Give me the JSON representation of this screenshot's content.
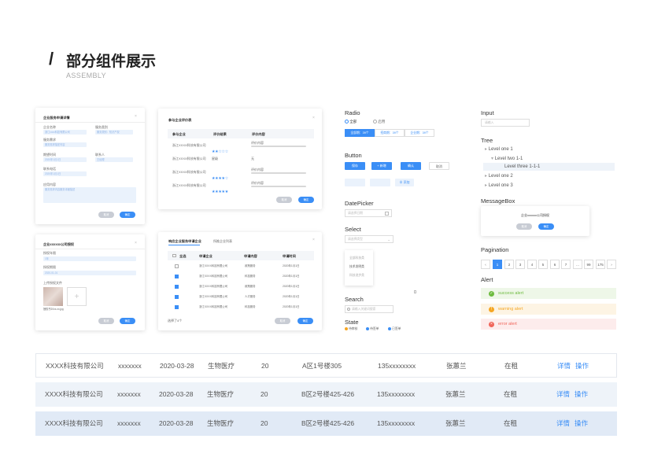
{
  "header": {
    "slash": "/",
    "title": "部分组件展示",
    "subtitle": "ASSEMBLY"
  },
  "card1": {
    "title": "企业服务申请详情",
    "labels": [
      "企业名称",
      "服务类别",
      "服务需求",
      "期望时间",
      "联系电话",
      "联系人",
      "应用内容"
    ],
    "values": [
      "浙江xxxx科技有限公司",
      "服务类别：知识产权",
      "服务需求描述内容",
      "2020年1月1日",
      "2020年1月1日",
      "王经理",
      "服务需求内容服务详细描述"
    ],
    "btn_cancel": "取消",
    "btn_ok": "确定"
  },
  "card2": {
    "title": "参与企业评价表",
    "headers": [
      "参与企业",
      "评价结果",
      "评价内容"
    ],
    "rows": [
      {
        "company": "浙江XXXX科技有限公司",
        "stars": "★★☆☆☆",
        "content": "评价内容"
      },
      {
        "company": "浙江XXXX科技有限公司",
        "stars": "星级",
        "content": "无"
      },
      {
        "company": "浙江XXXX科技有限公司",
        "stars": "★★★★☆",
        "content": "评价内容"
      },
      {
        "company": "浙江XXXX科技有限公司",
        "stars": "★★★★★",
        "content": "评价内容"
      }
    ],
    "btn_cancel": "取消",
    "btn_ok": "确定"
  },
  "card3": {
    "title": "企业xxxxxx公司授权",
    "labels": [
      "授权年限",
      "授权期限",
      "上传授权文件"
    ],
    "values": [
      "1年",
      "2020-01-01"
    ],
    "file_name": "授权书20xx-xx.jpg",
    "plus": "+",
    "btn_cancel": "取消",
    "btn_ok": "确定"
  },
  "card4": {
    "tabs": [
      "响应企业服务申请企业",
      "所推企业列表"
    ],
    "headers": [
      "全选",
      "申请企业",
      "申请内容",
      "申请时间"
    ],
    "rows": [
      {
        "company": "浙江XXXX科技有限公司",
        "content": "政策服务",
        "time": "2020年1月1日",
        "checked": false
      },
      {
        "company": "浙江XXXX科技有限公司",
        "content": "科技服务",
        "time": "2020年1月1日",
        "checked": true
      },
      {
        "company": "浙江XXXX科技有限公司",
        "content": "政策服务",
        "time": "2020年1月1日",
        "checked": true
      },
      {
        "company": "浙江XXXX科技有限公司",
        "content": "人才服务",
        "time": "2020年1月1日",
        "checked": true
      },
      {
        "company": "浙江XXXX科技有限公司",
        "content": "科技服务",
        "time": "2020年1月1日",
        "checked": true
      }
    ],
    "footer": "选择了4个",
    "btn_cancel": "取消",
    "btn_ok": "确定"
  },
  "radio": {
    "title": "Radio",
    "options": [
      "全部",
      "启用"
    ],
    "segments": [
      "全部期：39个",
      "招商期：39个",
      "企业期：39个"
    ]
  },
  "button": {
    "title": "Button",
    "labels": [
      "保存",
      "+ 新增",
      "确认",
      "取消"
    ],
    "add_label": "⊕ 添加"
  },
  "datepicker": {
    "title": "DatePicker",
    "placeholder": "请选择日期"
  },
  "select": {
    "title": "Select",
    "placeholder": "请选择类型",
    "options": [
      "全部科技类",
      "技术发明类",
      "科技进步类"
    ]
  },
  "search": {
    "title": "Search",
    "placeholder": "请输入关键词搜索"
  },
  "state": {
    "title": "State",
    "items": [
      {
        "label": "待审核",
        "color": "#f5a623"
      },
      {
        "label": "待签单",
        "color": "#3a8ef6"
      },
      {
        "label": "已签单",
        "color": "#3a8ef6"
      }
    ]
  },
  "input": {
    "title": "Input",
    "placeholder": "请输入"
  },
  "tree": {
    "title": "Tree",
    "items": [
      "Level one 1",
      "Level two 1-1",
      "Level three 1-1-1",
      "Level one 2",
      "Level one 3"
    ]
  },
  "messagebox": {
    "title": "MessageBox",
    "text": "企业xxxxxx公司授权",
    "btn_cancel": "取消",
    "btn_ok": "确定"
  },
  "pagination": {
    "title": "Pagination",
    "pages": [
      "‹",
      "1",
      "2",
      "3",
      "4",
      "5",
      "6",
      "7",
      "...",
      "99",
      "175",
      "›"
    ]
  },
  "alert": {
    "title": "Alert",
    "items": [
      {
        "text": "success alert",
        "bg": "#eef7e8",
        "color": "#6dbb3f",
        "icon": "✓"
      },
      {
        "text": "warning alert",
        "bg": "#fdf4e4",
        "color": "#f5a623",
        "icon": "!"
      },
      {
        "text": "error alert",
        "bg": "#fdecec",
        "color": "#f0655a",
        "icon": "×"
      }
    ]
  },
  "table": {
    "rows": [
      {
        "company": "XXXX科技有限公司",
        "contact": "xxxxxxx",
        "date": "2020-03-28",
        "industry": "生物医疗",
        "num": "20",
        "address": "A区1号楼305",
        "phone": "135xxxxxxxx",
        "person": "张蕙兰",
        "status": "在租",
        "detail": "详情",
        "action": "操作"
      },
      {
        "company": "XXXX科技有限公司",
        "contact": "xxxxxxx",
        "date": "2020-03-28",
        "industry": "生物医疗",
        "num": "20",
        "address": "B区2号楼425-426",
        "phone": "135xxxxxxxx",
        "person": "张蕙兰",
        "status": "在租",
        "detail": "详情",
        "action": "操作"
      },
      {
        "company": "XXXX科技有限公司",
        "contact": "xxxxxxx",
        "date": "2020-03-28",
        "industry": "生物医疗",
        "num": "20",
        "address": "B区2号楼425-426",
        "phone": "135xxxxxxxx",
        "person": "张蕙兰",
        "status": "在租",
        "detail": "详情",
        "action": "操作"
      }
    ]
  }
}
